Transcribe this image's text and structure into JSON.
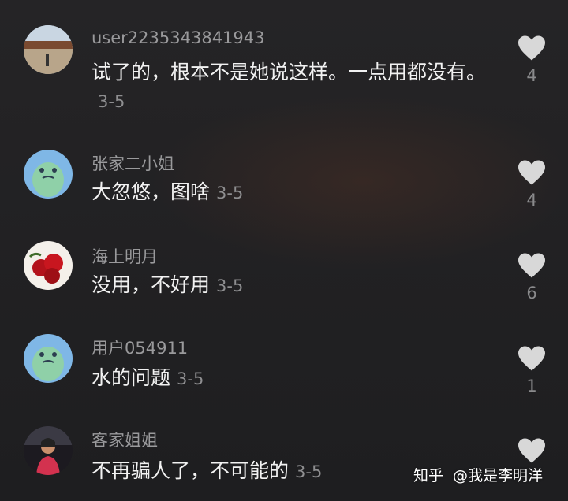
{
  "comments": [
    {
      "username": "user2235343841943",
      "text": "试了的，根本不是她说这样。一点用都没有。",
      "date": "3-5",
      "likes": "4",
      "avatar": "landscape-photo"
    },
    {
      "username": "张家二小姐",
      "text": "大忽悠，图啥",
      "date": "3-5",
      "likes": "4",
      "avatar": "green-cartoon"
    },
    {
      "username": "海上明月",
      "text": "没用，不好用",
      "date": "3-5",
      "likes": "6",
      "avatar": "red-roses"
    },
    {
      "username": "用户054911",
      "text": "水的问题",
      "date": "3-5",
      "likes": "1",
      "avatar": "green-cartoon"
    },
    {
      "username": "客家姐姐",
      "text": "不再骗人了，不可能的",
      "date": "3-5",
      "likes": "",
      "avatar": "person-photo"
    }
  ],
  "watermark": {
    "site": "知乎",
    "author": "@我是李明洋"
  },
  "colors": {
    "background": "#232325",
    "text": "#f2f2f2",
    "muted": "#9a9a9c",
    "heart": "#d8d8d8"
  }
}
